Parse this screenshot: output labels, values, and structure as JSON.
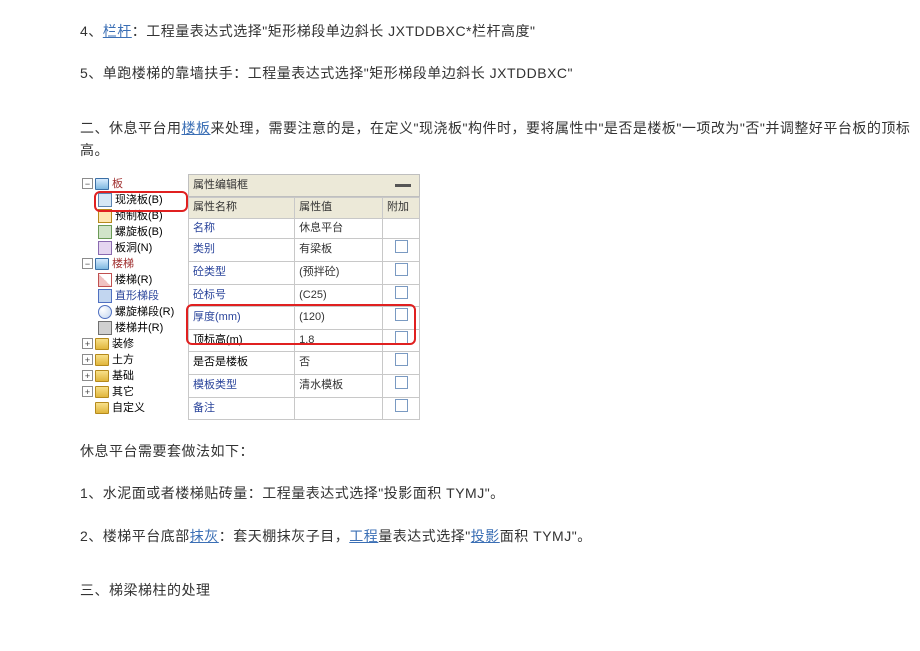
{
  "paragraphs": {
    "p4_prefix": "4、",
    "p4_link": "栏杆",
    "p4_rest": "：工程量表达式选择\"矩形梯段单边斜长 JXTDDBXC*栏杆高度\"",
    "p5": "5、单跑楼梯的靠墙扶手：工程量表达式选择\"矩形梯段单边斜长 JXTDDBXC\"",
    "s2a": "二、休息平台用",
    "s2link": "楼板",
    "s2b": "来处理，需要注意的是，在定义\"现浇板\"构件时，要将属性中\"是否是楼板\"一项改为\"否\"并调整好平台板的顶标高。",
    "rest_intro": "休息平台需要套做法如下：",
    "rest1": "1、水泥面或者楼梯贴砖量：工程量表达式选择\"投影面积 TYMJ\"。",
    "rest2a": "2、楼梯平台底部",
    "rest2link1": "抹灰",
    "rest2b": "：套天棚抹灰子目，",
    "rest2link2": "工程",
    "rest2c": "量表达式选择\"",
    "rest2link3": "投影",
    "rest2d": "面积 TYMJ\"。",
    "s3": "三、梯梁梯柱的处理"
  },
  "tree": {
    "root1": "板",
    "items1": [
      "现浇板(B)",
      "预制板(B)",
      "螺旋板(B)",
      "板洞(N)"
    ],
    "root2": "楼梯",
    "items2": [
      "楼梯(R)",
      "直形梯段",
      "螺旋梯段(R)",
      "楼梯井(R)"
    ],
    "roots_more": [
      "装修",
      "土方",
      "基础",
      "其它",
      "自定义"
    ]
  },
  "grid": {
    "title": "属性编辑框",
    "headers": [
      "属性名称",
      "属性值",
      "附加"
    ],
    "rows": [
      {
        "name": "名称",
        "val": "休息平台",
        "chk": false,
        "nameBlue": true
      },
      {
        "name": "类别",
        "val": "有梁板",
        "chk": true,
        "nameBlue": true
      },
      {
        "name": "砼类型",
        "val": "(预拌砼)",
        "chk": true,
        "nameBlue": true
      },
      {
        "name": "砼标号",
        "val": "(C25)",
        "chk": true,
        "nameBlue": true
      },
      {
        "name": "厚度(mm)",
        "val": "(120)",
        "chk": true,
        "nameBlue": true
      },
      {
        "name": "顶标高(m)",
        "val": "1.8",
        "chk": true,
        "nameBlue": false
      },
      {
        "name": "是否是楼板",
        "val": "否",
        "chk": true,
        "nameBlue": false
      },
      {
        "name": "模板类型",
        "val": "清水模板",
        "chk": true,
        "nameBlue": true
      },
      {
        "name": "备注",
        "val": "",
        "chk": true,
        "nameBlue": true
      }
    ]
  }
}
